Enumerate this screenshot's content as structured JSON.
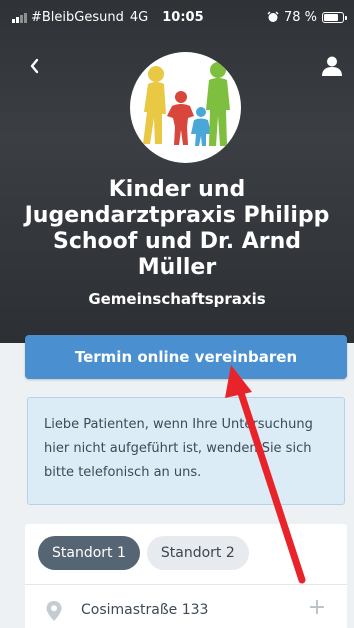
{
  "status_bar": {
    "carrier": "#BleibGesund",
    "network": "4G",
    "time": "10:05",
    "battery": "78 %",
    "battery_level": 0.78
  },
  "header": {
    "practice_name": "Kinder und Jugendarztpraxis Philipp Schoof und Dr. Arnd Müller",
    "practice_type": "Gemeinschaftspraxis"
  },
  "booking": {
    "button_label": "Termin online vereinbaren"
  },
  "notice": {
    "text": "Liebe Patienten, wenn Ihre Untersuchung hier nicht aufgeführt ist, wenden Sie sich bitte telefonisch an uns."
  },
  "locations": {
    "tabs": [
      {
        "label": "Standort 1",
        "active": true
      },
      {
        "label": "Standort 2",
        "active": false
      }
    ],
    "address": "Cosimastraße 133"
  },
  "colors": {
    "primary": "#4a90d0",
    "tab_active": "#566573",
    "notice_bg": "#dcecf7",
    "annotation": "#e8232a"
  }
}
